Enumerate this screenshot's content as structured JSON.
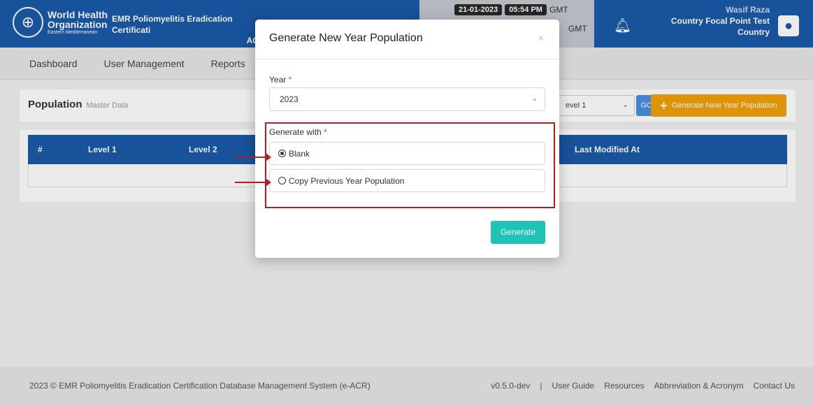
{
  "header": {
    "org_line1": "World Health",
    "org_line2": "Organization",
    "org_line3": "Eastern Mediterranean",
    "system_title": "EMR Poliomyelitis Eradication Certificati",
    "system_title_sub": "AC",
    "date": "21-01-2023",
    "time": "05:54 PM",
    "tz1": "GMT",
    "tz2": "GMT",
    "user_name": "Wasif Raza",
    "user_role": "Country Focal Point Test",
    "user_scope": "Country"
  },
  "nav": {
    "items": [
      "Dashboard",
      "User Management",
      "Reports"
    ]
  },
  "page": {
    "title": "Population",
    "subtitle": "Master Data",
    "level_select": "evel 1",
    "go_label": "GO",
    "generate_label": "Generate New Year Population"
  },
  "table": {
    "headers": [
      "#",
      "Level 1",
      "Level 2",
      "Last Modified At"
    ]
  },
  "modal": {
    "title": "Generate New Year Population",
    "close": "×",
    "year_label": "Year",
    "year_value": "2023",
    "generate_with_label": "Generate with",
    "required_mark": "*",
    "option_blank": "Blank",
    "option_copy": "Copy Previous Year Population",
    "generate_button": "Generate"
  },
  "footer": {
    "left": "2023 ©  EMR Poliomyelitis Eradication Certification Database Management System (e-ACR)",
    "version": "v0.5.0-dev",
    "divider": "|",
    "links": [
      "User Guide",
      "Resources",
      "Abbreviation & Acronym",
      "Contact Us"
    ]
  }
}
